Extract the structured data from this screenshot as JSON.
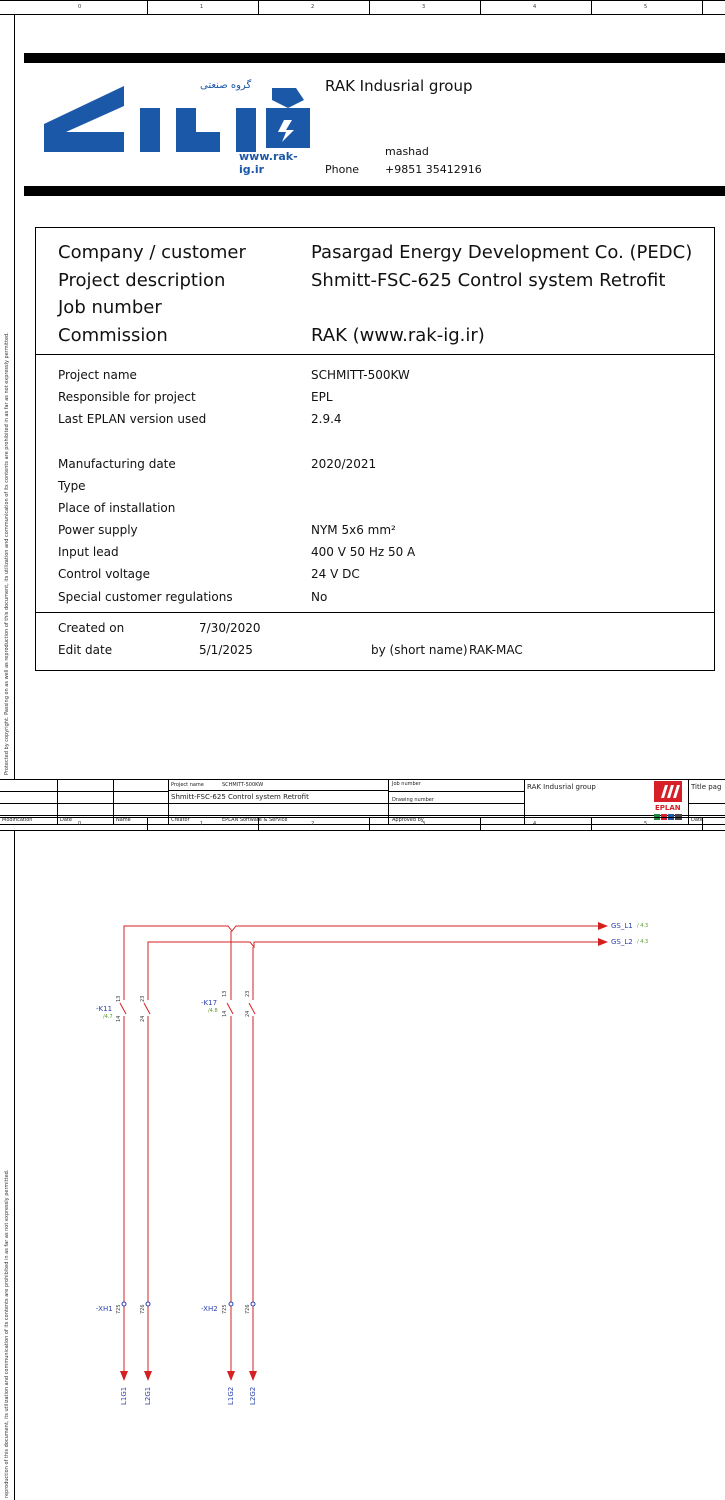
{
  "ruler_labels": [
    "0",
    "1",
    "2",
    "3",
    "4",
    "5"
  ],
  "side_text_1": "Protected by copyright. Passing on as well as reproduction of this document, its utilization and communication of its contents are prohibited in as far as not expressly permitted.",
  "side_text_2": "reproduction of this document, its utilization and communication of its contents are prohibited in as far as not expressly permitted.",
  "header": {
    "logo_text": "لراک",
    "logo_subtitle": "گروه صنعتی",
    "logo_url": "www.rak-ig.ir",
    "company": "RAK Indusrial group",
    "city": "mashad",
    "phone_label": "Phone",
    "phone_value": "+9851 35412916"
  },
  "main_fields": [
    {
      "label": "Company / customer",
      "value": "Pasargad Energy Development Co. (PEDC)"
    },
    {
      "label": "Project description",
      "value": "Shmitt-FSC-625 Control system Retrofit"
    },
    {
      "label": "Job number",
      "value": ""
    },
    {
      "label": "Commission",
      "value": "RAK (www.rak-ig.ir)"
    }
  ],
  "detail_fields": [
    {
      "label": "Project name",
      "value": "SCHMITT-500KW"
    },
    {
      "label": "Responsible for project",
      "value": "EPL"
    },
    {
      "label": "Last EPLAN version used",
      "value": "2.9.4"
    },
    {
      "label": "Manufacturing date",
      "value": "2020/2021"
    },
    {
      "label": "Type",
      "value": ""
    },
    {
      "label": "Place of installation",
      "value": ""
    },
    {
      "label": "Power supply",
      "value": "NYM 5x6 mm²"
    },
    {
      "label": "Input lead",
      "value": "400 V 50 Hz 50 A"
    },
    {
      "label": "Control voltage",
      "value": "24 V DC"
    },
    {
      "label": "Special customer regulations",
      "value": "No"
    }
  ],
  "dates": {
    "created_label": "Created on",
    "created_value": "7/30/2020",
    "edit_label": "Edit date",
    "edit_value": "5/1/2025",
    "by_label": "by (short name)",
    "by_value": "RAK-MAC"
  },
  "title_block": {
    "project_name_label": "Project name",
    "project_name_value": "SCHMITT-500KW",
    "project_desc": "Shmitt-FSC-625 Control system Retrofit",
    "creator_label": "Creator",
    "creator_value": "EPLAN Software & Service",
    "job_number_label": "Job number",
    "drawing_number_label": "Drawing number",
    "approved_by_label": "Approved by",
    "company": "RAK Indusrial group",
    "eplan_logo": "EPLAN",
    "title_page_label": "Title pag",
    "date_label": "Date",
    "modification_label": "Modification",
    "date_col_label": "Date",
    "name_col_label": "Name"
  },
  "schematic": {
    "outputs": [
      {
        "name": "GS_L1",
        "ref": "/ 4.3"
      },
      {
        "name": "GS_L2",
        "ref": "/ 4.3"
      }
    ],
    "k11": {
      "name": "-K11",
      "ref": "/4.7",
      "contacts": [
        "13",
        "14",
        "23",
        "24"
      ]
    },
    "k17": {
      "name": "-K17",
      "ref": "/4.8",
      "contacts": [
        "13",
        "14",
        "23",
        "24"
      ]
    },
    "xh1": {
      "name": "-XH1",
      "terminals": [
        "725",
        "726"
      ]
    },
    "xh2": {
      "name": "-XH2",
      "terminals": [
        "725",
        "726"
      ]
    },
    "bottom_refs": [
      "L1G1",
      "L2G1",
      "L1G2",
      "L2G2"
    ],
    "wire_color": "#d42020",
    "label_color": "#2a3fb0",
    "ref_color": "#5a9a2a"
  }
}
